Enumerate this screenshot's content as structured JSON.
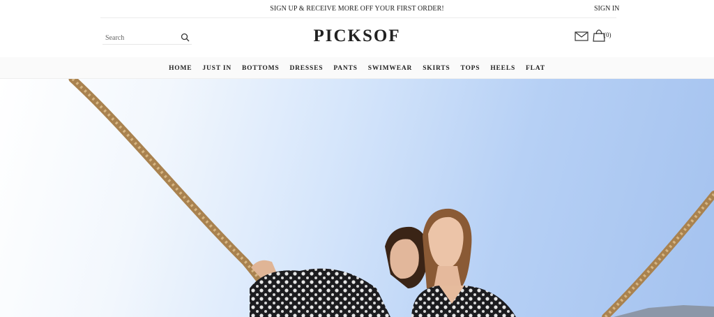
{
  "topbar": {
    "promo": "SIGN UP & RECEIVE MORE OFF YOUR FIRST ORDER!",
    "signin": "SIGN IN"
  },
  "header": {
    "logo": "PICKSOF",
    "search_placeholder": "Search",
    "search_icon": "search-icon",
    "mail_icon": "mail-icon",
    "bag_icon": "shopping-bag-icon",
    "cart_count": "(0)"
  },
  "nav": {
    "items": [
      "HOME",
      "JUST IN",
      "BOTTOMS",
      "DRESSES",
      "PANTS",
      "SWIMWEAR",
      "SKIRTS",
      "TOPS",
      "HEELS",
      "FLAT"
    ]
  },
  "hero": {
    "image": "two women in polka-dot dresses holding ropes against a blue sky"
  },
  "colors": {
    "text": "#222222",
    "nav_bg": "#fafafa",
    "sky": "#a4c2ef",
    "rope": "#b08a58"
  }
}
